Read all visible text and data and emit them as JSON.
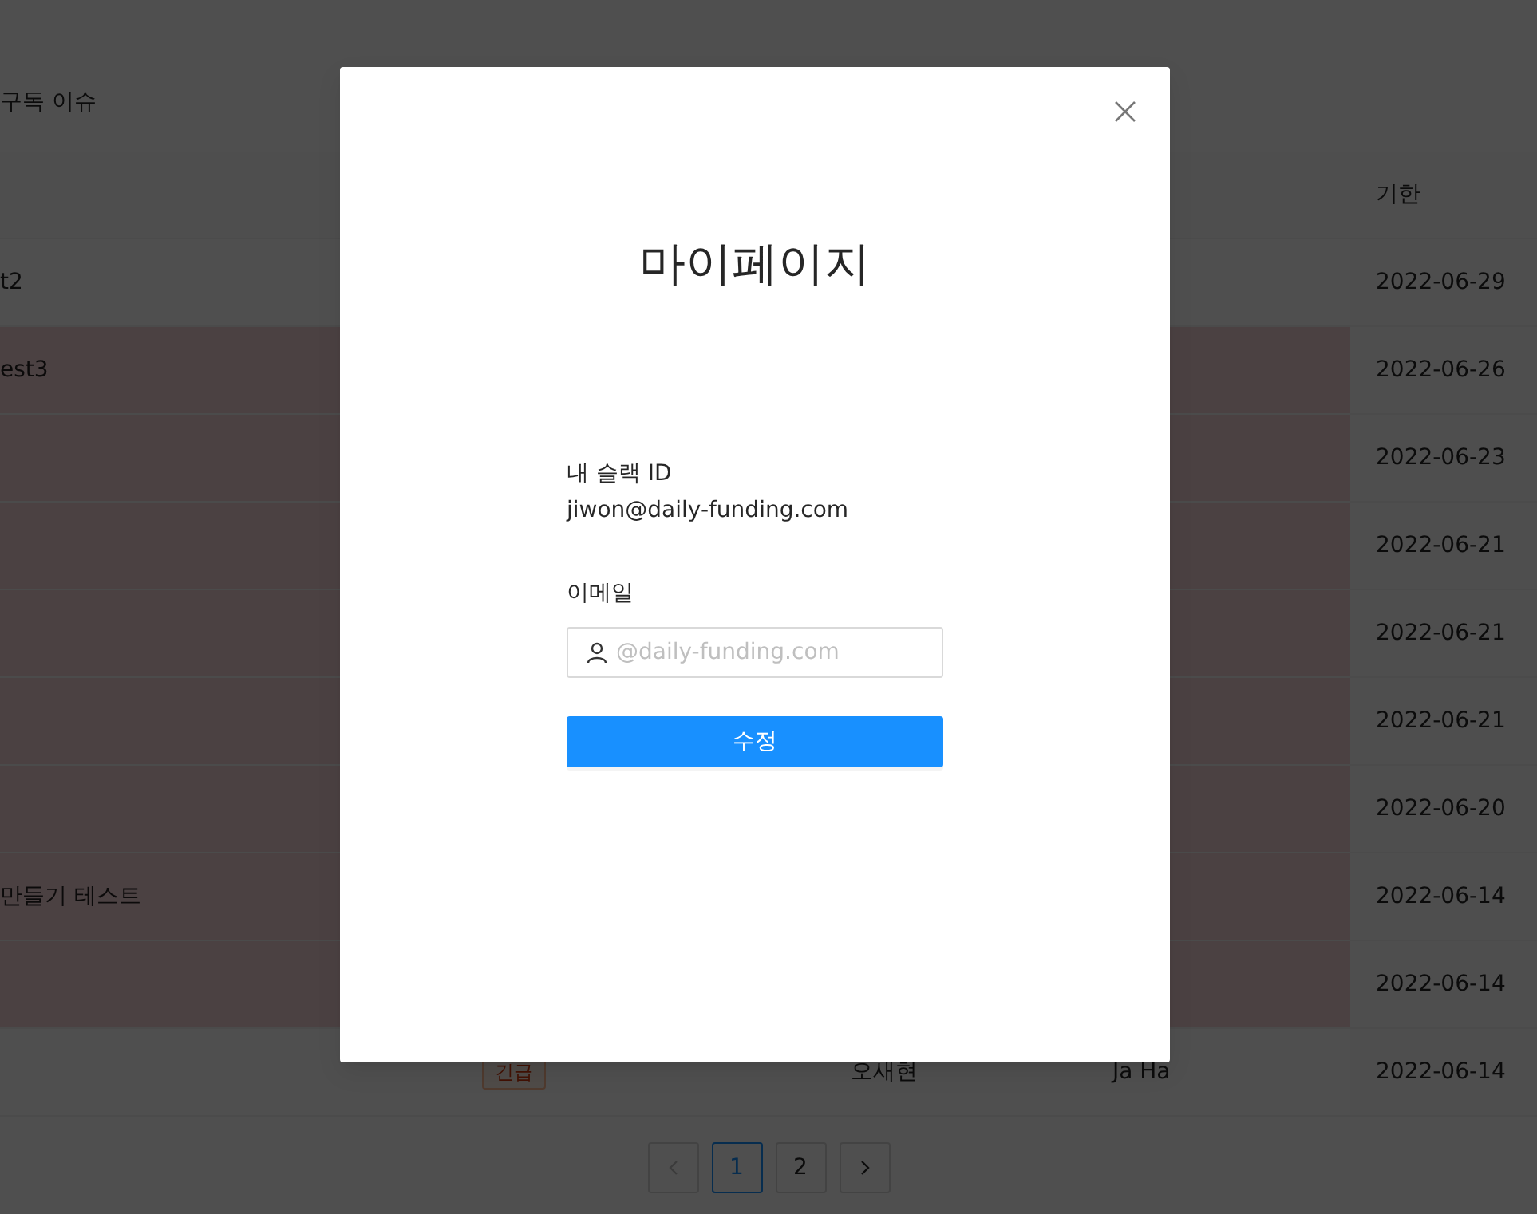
{
  "page": {
    "section_title": "구독 이슈"
  },
  "table": {
    "columns": [
      {},
      {},
      {},
      {},
      {
        "label": "기한"
      }
    ],
    "rows": [
      {
        "title": "t2",
        "due": "2022-06-29",
        "highlighted": false
      },
      {
        "title": "est3",
        "due": "2022-06-26",
        "highlighted": true
      },
      {
        "due": "2022-06-23",
        "highlighted": true
      },
      {
        "due": "2022-06-21",
        "highlighted": true
      },
      {
        "due": "2022-06-21",
        "highlighted": true
      },
      {
        "due": "2022-06-21",
        "highlighted": true
      },
      {
        "due": "2022-06-20",
        "highlighted": true
      },
      {
        "title": "만들기 테스트",
        "due": "2022-06-14",
        "highlighted": true
      },
      {
        "due": "2022-06-14",
        "highlighted": true
      },
      {
        "tag": "긴급",
        "assignee": "오새현",
        "requester": "Ja Ha",
        "due": "2022-06-14",
        "highlighted": false
      }
    ]
  },
  "pagination": {
    "prev": {
      "disabled": true
    },
    "pages": [
      {
        "label": "1",
        "selected": true
      },
      {
        "label": "2",
        "selected": false
      }
    ],
    "next": {
      "disabled": false
    }
  },
  "modal": {
    "title": "마이페이지",
    "slack_label": "내 슬랙 ID",
    "slack_value": "jiwon@daily-funding.com",
    "email_label": "이메일",
    "email_field": {
      "placeholder": "@daily-funding.com"
    },
    "submit_button": "수정"
  }
}
